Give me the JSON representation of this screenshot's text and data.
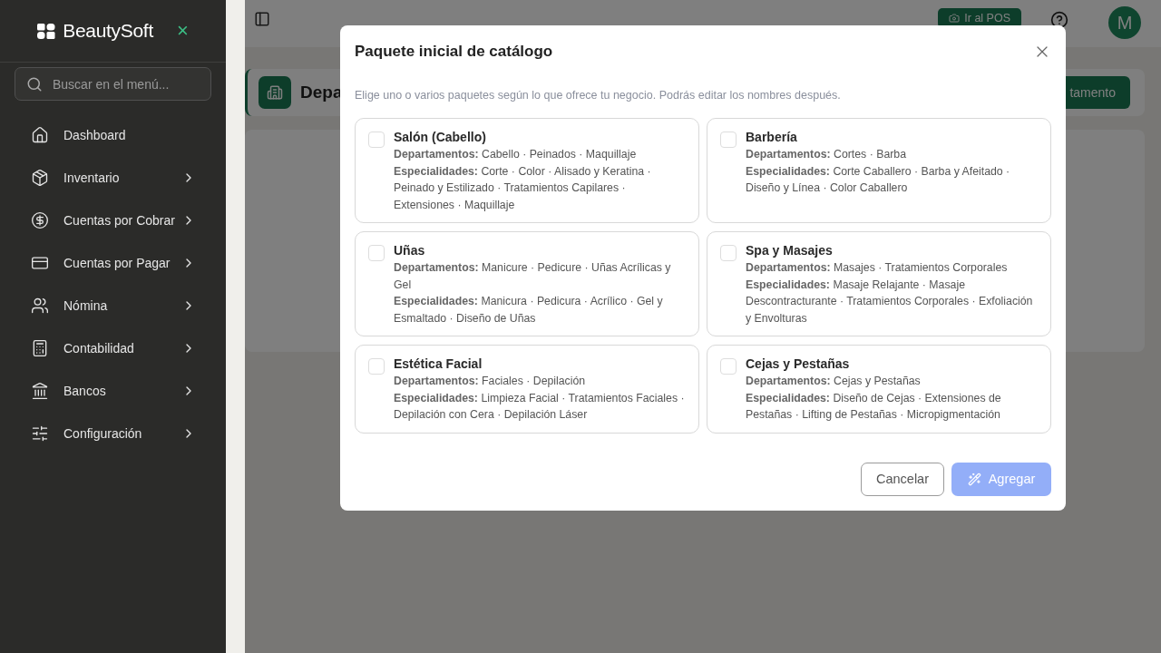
{
  "sidebar": {
    "brand": "BeautySoft",
    "close": "×",
    "search": {
      "placeholder": "Buscar en el menú..."
    },
    "items": [
      {
        "label": "Dashboard",
        "kind": "link"
      },
      {
        "label": "Inventario",
        "kind": "group"
      },
      {
        "label": "Cuentas por Cobrar",
        "kind": "group"
      },
      {
        "label": "Cuentas por Pagar",
        "kind": "group"
      },
      {
        "label": "Nómina",
        "kind": "group"
      },
      {
        "label": "Contabilidad",
        "kind": "group"
      },
      {
        "label": "Bancos",
        "kind": "group"
      },
      {
        "label": "Configuración",
        "kind": "group"
      }
    ]
  },
  "header": {
    "pos_button": "Ir al POS",
    "avatar": "M"
  },
  "page": {
    "title": "Depa",
    "action_button": "tamento"
  },
  "dialog": {
    "title": "Paquete inicial de catálogo",
    "description": "Elige uno o varios paquetes según lo que ofrece tu negocio. Podrás editar los nombres después.",
    "packages": [
      {
        "name": "Salón (Cabello)",
        "checked": false,
        "departments": "**Departamentos:** Cabello · Peinados · Maquillaje",
        "specialties": "**Especialidades:** Corte · Color · Alisado y Keratina · Peinado y Estilizado · Tratamientos Capilares · Extensiones · Maquillaje"
      },
      {
        "name": "Barbería",
        "checked": false,
        "departments": "**Departamentos:** Cortes · Barba",
        "specialties": "**Especialidades:** Corte Caballero · Barba y Afeitado · Diseño y Línea · Color Caballero"
      },
      {
        "name": "Uñas",
        "checked": false,
        "departments": "**Departamentos:** Manicure · Pedicure · Uñas Acrílicas y Gel",
        "specialties": "**Especialidades:** Manicura · Pedicura · Acrílico · Gel y Esmaltado · Diseño de Uñas"
      },
      {
        "name": "Spa y Masajes",
        "checked": false,
        "departments": "**Departamentos:** Masajes · Tratamientos Corporales",
        "specialties": "**Especialidades:** Masaje Relajante · Masaje Descontracturante · Tratamientos Corporales · Exfoliación y Envolturas"
      },
      {
        "name": "Estética Facial",
        "checked": false,
        "departments": "**Departamentos:** Faciales · Depilación",
        "specialties": "**Especialidades:** Limpieza Facial · Tratamientos Faciales · Depilación con Cera · Depilación Láser"
      },
      {
        "name": "Cejas y Pestañas",
        "checked": false,
        "departments": "**Departamentos:** Cejas y Pestañas",
        "specialties": "**Especialidades:** Diseño de Cejas · Extensiones de Pestañas · Lifting de Pestañas · Micropigmentación"
      }
    ],
    "cancel_button": "Cancelar",
    "add_button": {
      "label": "Agregar",
      "disabled": true
    }
  }
}
